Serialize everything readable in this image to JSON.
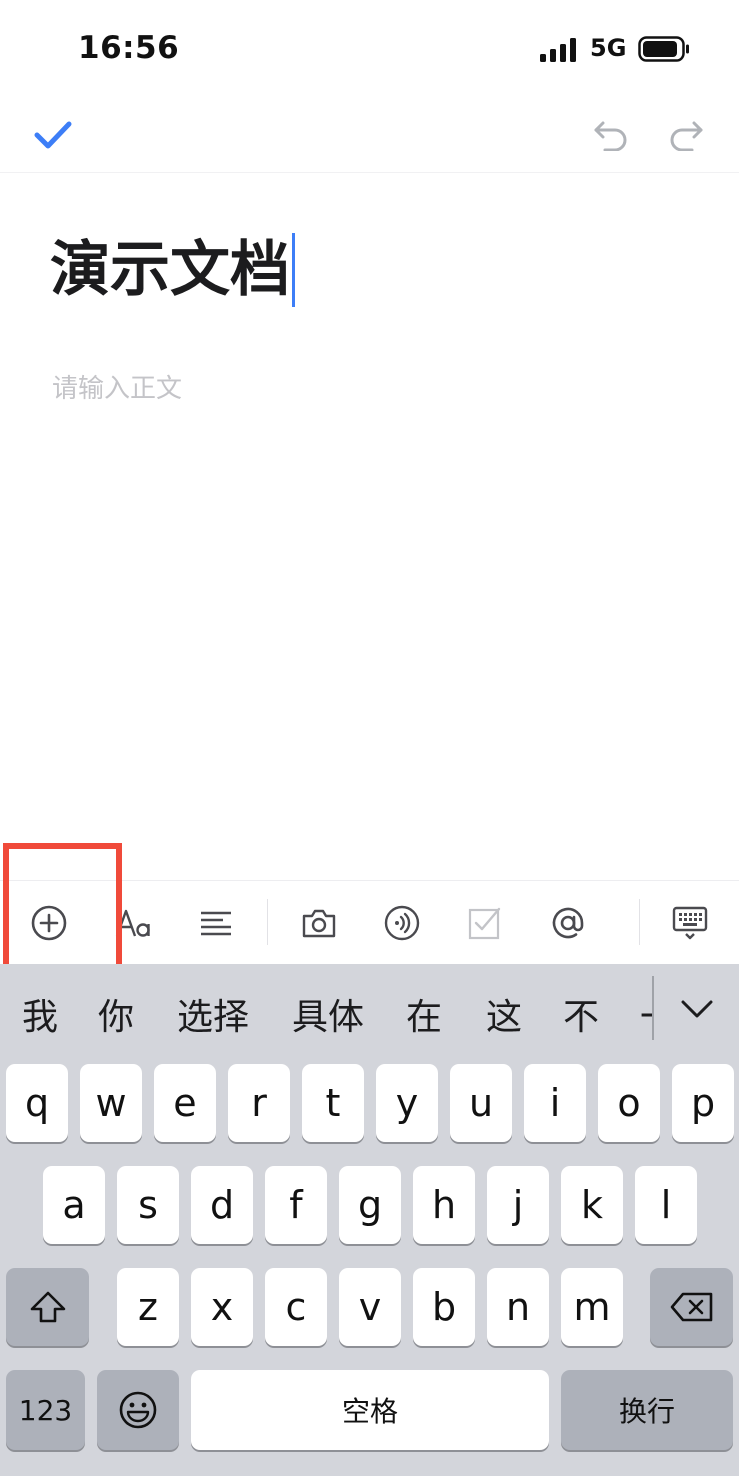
{
  "status_bar": {
    "time": "16:56",
    "network": "5G"
  },
  "top_bar": {
    "done_icon": "checkmark-icon",
    "undo_icon": "undo-icon",
    "redo_icon": "redo-icon"
  },
  "document": {
    "title": "演示文档",
    "body_placeholder": "请输入正文"
  },
  "format_toolbar": {
    "items": [
      "add-circle-icon",
      "text-style-icon",
      "align-icon",
      "camera-icon",
      "voice-icon",
      "checkbox-icon",
      "mention-icon",
      "keyboard-hide-icon"
    ]
  },
  "keyboard": {
    "candidates": [
      "我",
      "你",
      "选择",
      "具体",
      "在",
      "这",
      "不",
      "一"
    ],
    "row1": [
      "q",
      "w",
      "e",
      "r",
      "t",
      "y",
      "u",
      "i",
      "o",
      "p"
    ],
    "row2": [
      "a",
      "s",
      "d",
      "f",
      "g",
      "h",
      "j",
      "k",
      "l"
    ],
    "row3": [
      "z",
      "x",
      "c",
      "v",
      "b",
      "n",
      "m"
    ],
    "numbers_label": "123",
    "space_label": "空格",
    "return_label": "换行"
  },
  "colors": {
    "accent": "#3d7ef7",
    "highlight": "#f04a3a",
    "keyboard_bg": "#d3d5db"
  }
}
